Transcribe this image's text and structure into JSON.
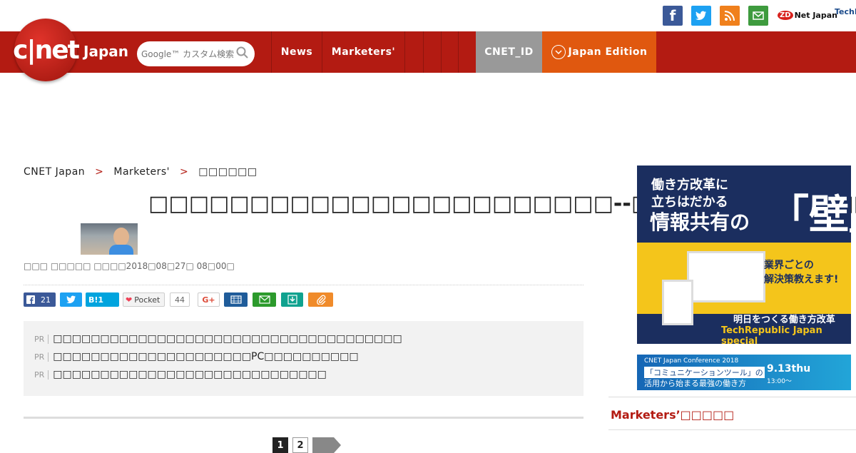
{
  "top_links": {
    "facebook": "f",
    "twitter": "t",
    "rss": "rss",
    "mail": "mail",
    "zdnet_mark": "ZD",
    "zdnet_text": "Net Japan",
    "techrepublic_text": "TechRepublic"
  },
  "header": {
    "logo_text": "c|net",
    "logo_region": "Japan",
    "search_placeholder": "Google™ カスタム検索",
    "nav": [
      {
        "label": "News"
      },
      {
        "label": "Marketers'"
      },
      {
        "label": ""
      },
      {
        "label": ""
      },
      {
        "label": ""
      },
      {
        "label": ""
      },
      {
        "label": "CNET_ID"
      },
      {
        "label": "Japan Edition"
      }
    ],
    "colors": {
      "brand": "#b31b12",
      "cnet_id": "#999999",
      "edition": "#e0580f"
    }
  },
  "breadcrumb": {
    "items": [
      "CNET Japan",
      "Marketers'",
      "□□□□□□"
    ],
    "separator": ">"
  },
  "article": {
    "title": "□□□□□□□□□□□□□□□□□□□□□□□--□□□□□□□□□□□□",
    "byline": "□□□ □□□□□ □□□□2018□08□27□ 08□00□"
  },
  "share": {
    "facebook_count": "21",
    "hatena_label": "B!",
    "hatena_count": "1",
    "pocket_label": "Pocket",
    "pocket_count": "44",
    "gplus_label": "G+"
  },
  "pr": {
    "tag": "PR",
    "items": [
      "□□□□□□□□□□□□□□□□□□□□□□□□□□□□□□□□□□□□□",
      "□□□□□□□□□□□□□□□□□□□□□PC□□□□□□□□□□",
      "□□□□□□□□□□□□□□□□□□□□□□□□□□□□□"
    ]
  },
  "pager": {
    "current": "1",
    "next": "2"
  },
  "sidebar": {
    "ad1": {
      "line1": "働き方改革に",
      "line2": "立ちはだかる",
      "line3": "情報共有の",
      "wall": "「壁」",
      "yellow1": "業界ごとの",
      "yellow2": "解決策教えます!",
      "bottom1": "明日をつくる働き方改革",
      "bottom2": "TechRepublic Japan special"
    },
    "ad2": {
      "conf": "CNET Japan Conference 2018",
      "line1": "「コミュニケーションツール」の",
      "line2": "活用から始まる最強の働き方",
      "date": "9.13thu",
      "time": "13:00〜"
    },
    "section_title": "Marketers’□□□□□"
  }
}
